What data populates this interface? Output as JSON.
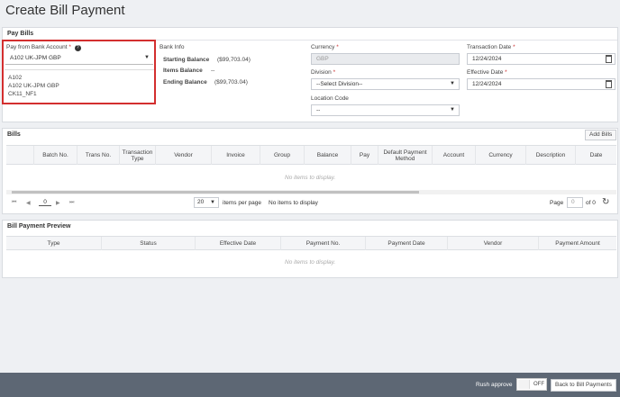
{
  "page": {
    "title": "Create Bill Payment"
  },
  "pay_bills": {
    "section_title": "Pay Bills",
    "bank_account": {
      "label": "Pay from Bank Account",
      "required": "*",
      "help_icon": "help-icon",
      "value": "A102 UK-JPM GBP",
      "options": [
        "A102",
        "A102 UK-JPM GBP",
        "CK11_NF1"
      ]
    },
    "bank_info": {
      "label": "Bank Info",
      "starting_balance_label": "Starting Balance",
      "starting_balance": "($99,703.04)",
      "items_balance_label": "Items Balance",
      "items_balance": "--",
      "ending_balance_label": "Ending Balance",
      "ending_balance": "($99,703.04)"
    },
    "currency": {
      "label": "Currency",
      "required": "*",
      "value": "GBP"
    },
    "division": {
      "label": "Division",
      "required": "*",
      "placeholder": "--Select Division--"
    },
    "location_code": {
      "label": "Location Code",
      "placeholder": "--"
    },
    "transaction_date": {
      "label": "Transaction Date",
      "required": "*",
      "value": "12/24/2024"
    },
    "effective_date": {
      "label": "Effective Date",
      "required": "*",
      "value": "12/24/2024"
    }
  },
  "bills": {
    "section_title": "Bills",
    "add_button": "Add Bills",
    "columns": [
      "Batch No.",
      "Trans No.",
      "Transaction Type",
      "Vendor",
      "Invoice",
      "Group",
      "Balance",
      "Pay",
      "Default Payment Method",
      "Account",
      "Currency",
      "Description",
      "Date"
    ],
    "empty_text": "No items to display.",
    "pager": {
      "current_page": "0",
      "page_size": "20",
      "items_per_page_label": "items per page",
      "status": "No items to display",
      "page_label": "Page",
      "page_input": "0",
      "of_label": "of 0"
    }
  },
  "preview": {
    "section_title": "Bill Payment Preview",
    "columns": [
      "Type",
      "Status",
      "Effective Date",
      "Payment No.",
      "Payment Date",
      "Vendor",
      "Payment Amount"
    ],
    "empty_text": "No items to display."
  },
  "footer": {
    "rush_label": "Rush approve",
    "toggle_state": "OFF",
    "back_button": "Back to Bill Payments"
  },
  "colors": {
    "highlight": "#d32f2f",
    "footer_bg": "#5d6774"
  }
}
